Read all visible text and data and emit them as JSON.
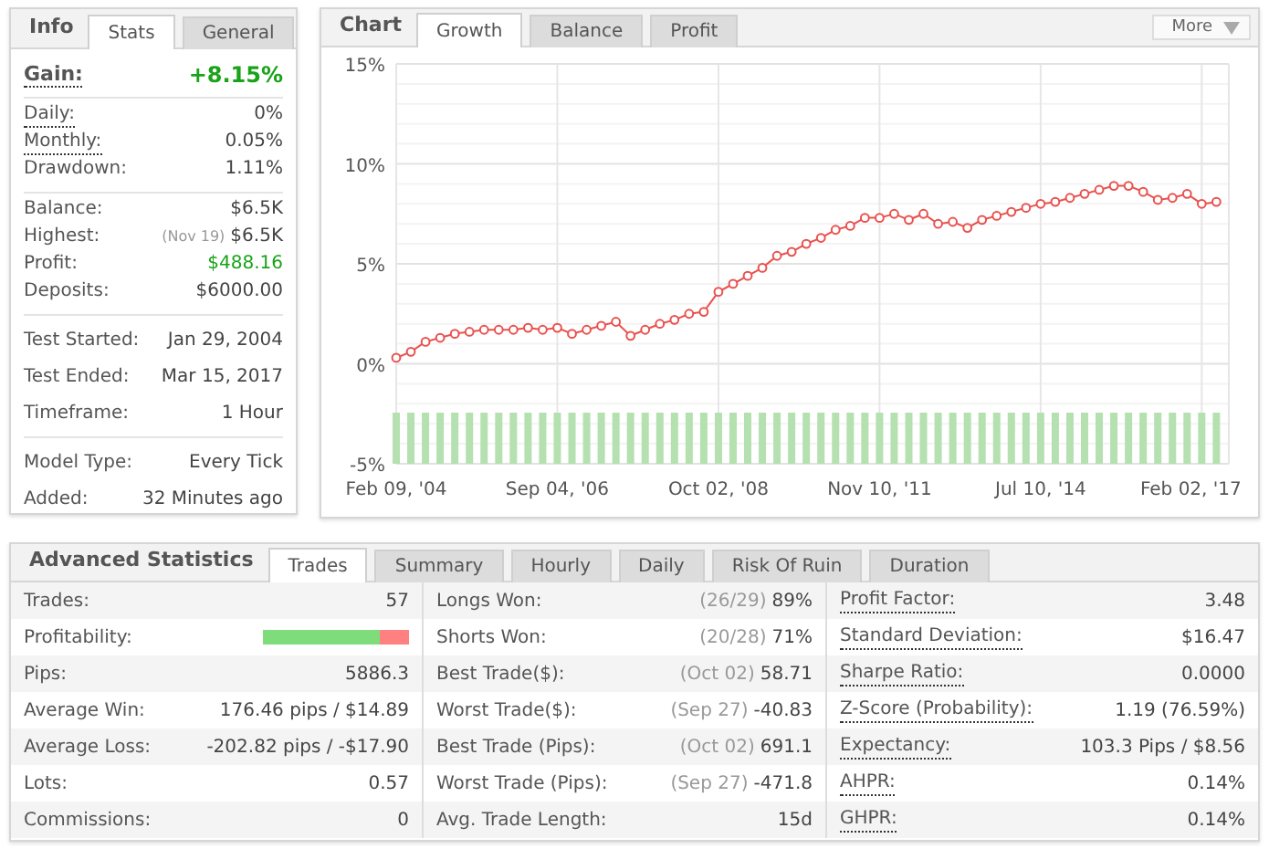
{
  "info": {
    "title": "Info",
    "tabs": [
      {
        "label": "Stats",
        "selected": true
      },
      {
        "label": "General",
        "selected": false
      }
    ],
    "gain": {
      "label": "Gain:",
      "value": "+8.15%",
      "dotted": true
    },
    "groups": [
      {
        "rows": [
          {
            "label": "Daily:",
            "value": "0%",
            "dotted": true,
            "positive": false
          },
          {
            "label": "Monthly:",
            "value": "0.05%",
            "dotted": true,
            "positive": false
          },
          {
            "label": "Drawdown:",
            "value": "1.11%",
            "dotted": false,
            "positive": false
          }
        ]
      },
      {
        "rows": [
          {
            "label": "Balance:",
            "value": "$6.5K",
            "dotted": false,
            "positive": false
          },
          {
            "label": "Highest:",
            "note": "(Nov 19)",
            "value": "$6.5K",
            "dotted": false,
            "positive": false
          },
          {
            "label": "Profit:",
            "value": "$488.16",
            "dotted": false,
            "positive": true
          },
          {
            "label": "Deposits:",
            "value": "$6000.00",
            "dotted": false,
            "positive": false
          }
        ]
      },
      {
        "rows": [
          {
            "label": "Test Started:",
            "value": "Jan 29, 2004",
            "dotted": false,
            "positive": false
          },
          {
            "label": "Test Ended:",
            "value": "Mar 15, 2017",
            "dotted": false,
            "positive": false
          },
          {
            "label": "Timeframe:",
            "value": "1 Hour",
            "dotted": false,
            "positive": false
          }
        ]
      },
      {
        "rows": [
          {
            "label": "Model Type:",
            "value": "Every Tick",
            "dotted": false,
            "positive": false
          },
          {
            "label": "Added:",
            "value": "32 Minutes ago",
            "dotted": false,
            "positive": false
          }
        ]
      }
    ]
  },
  "chart": {
    "title": "Chart",
    "tabs": [
      {
        "label": "Growth",
        "selected": true
      },
      {
        "label": "Balance",
        "selected": false
      },
      {
        "label": "Profit",
        "selected": false
      }
    ],
    "more": "More",
    "chart_data": {
      "type": "line",
      "categories": [
        "Feb 09, '04",
        null,
        null,
        null,
        null,
        null,
        null,
        null,
        null,
        null,
        null,
        "Sep 04, '06",
        null,
        null,
        null,
        null,
        null,
        null,
        null,
        null,
        null,
        null,
        "Oct 02, '08",
        null,
        null,
        null,
        null,
        null,
        null,
        null,
        null,
        null,
        null,
        "Nov 10, '11",
        null,
        null,
        null,
        null,
        null,
        null,
        null,
        null,
        null,
        null,
        "Jul 10, '14",
        null,
        null,
        null,
        null,
        null,
        null,
        null,
        null,
        null,
        null,
        "Feb 02, '17",
        null
      ],
      "grid": true,
      "series": [
        {
          "marker": true,
          "color": "#e8524f",
          "values": [
            0.3,
            0.6,
            1.1,
            1.3,
            1.5,
            1.6,
            1.7,
            1.7,
            1.7,
            1.8,
            1.7,
            1.8,
            1.5,
            1.7,
            1.9,
            2.1,
            1.4,
            1.7,
            2.0,
            2.2,
            2.5,
            2.6,
            3.6,
            4.0,
            4.4,
            4.8,
            5.4,
            5.6,
            6.0,
            6.3,
            6.7,
            6.9,
            7.3,
            7.3,
            7.5,
            7.2,
            7.5,
            7.0,
            7.1,
            6.8,
            7.2,
            7.4,
            7.6,
            7.8,
            8.0,
            8.1,
            8.3,
            8.5,
            8.7,
            8.9,
            8.9,
            8.6,
            8.2,
            8.3,
            8.5,
            8.0,
            8.1
          ]
        }
      ],
      "ylim": [
        -5,
        15
      ],
      "yticks": [
        {
          "value": 15,
          "label": "15%"
        },
        {
          "value": 10,
          "label": "10%"
        },
        {
          "value": 5,
          "label": "5%"
        },
        {
          "value": 0,
          "label": "0%"
        },
        {
          "value": -5,
          "label": "-5%"
        }
      ]
    }
  },
  "advanced": {
    "title": "Advanced Statistics",
    "tabs": [
      {
        "label": "Trades",
        "selected": true
      },
      {
        "label": "Summary",
        "selected": false
      },
      {
        "label": "Hourly",
        "selected": false
      },
      {
        "label": "Daily",
        "selected": false
      },
      {
        "label": "Risk Of Ruin",
        "selected": false
      },
      {
        "label": "Duration",
        "selected": false
      }
    ],
    "columns": [
      [
        {
          "kind": "text",
          "label": "Trades:",
          "value": "57",
          "dotted": false
        },
        {
          "kind": "bar",
          "label": "Profitability:",
          "level": 0.805,
          "dotted": false
        },
        {
          "kind": "text",
          "label": "Pips:",
          "value": "5886.3",
          "dotted": false
        },
        {
          "kind": "text",
          "label": "Average Win:",
          "value": "176.46 pips / $14.89",
          "dotted": false
        },
        {
          "kind": "text",
          "label": "Average Loss:",
          "value": "-202.82 pips / -$17.90",
          "dotted": false
        },
        {
          "kind": "text",
          "label": "Lots:",
          "value": "0.57",
          "dotted": false
        },
        {
          "kind": "text",
          "label": "Commissions:",
          "value": "0",
          "dotted": false
        }
      ],
      [
        {
          "kind": "text",
          "label": "Longs Won:",
          "note": "(26/29)",
          "value": "89%",
          "dotted": false
        },
        {
          "kind": "text",
          "label": "Shorts Won:",
          "note": "(20/28)",
          "value": "71%",
          "dotted": false
        },
        {
          "kind": "text",
          "label": "Best Trade($):",
          "note": "(Oct 02)",
          "value": "58.71",
          "dotted": false
        },
        {
          "kind": "text",
          "label": "Worst Trade($):",
          "note": "(Sep 27)",
          "value": "-40.83",
          "dotted": false
        },
        {
          "kind": "text",
          "label": "Best Trade (Pips):",
          "note": "(Oct 02)",
          "value": "691.1",
          "dotted": false
        },
        {
          "kind": "text",
          "label": "Worst Trade (Pips):",
          "note": "(Sep 27)",
          "value": "-471.8",
          "dotted": false
        },
        {
          "kind": "text",
          "label": "Avg. Trade Length:",
          "value": "15d",
          "dotted": false
        }
      ],
      [
        {
          "kind": "text",
          "label": "Profit Factor:",
          "value": "3.48",
          "dotted": true
        },
        {
          "kind": "text",
          "label": "Standard Deviation:",
          "value": "$16.47",
          "dotted": true
        },
        {
          "kind": "text",
          "label": "Sharpe Ratio:",
          "value": "0.0000",
          "dotted": true
        },
        {
          "kind": "text",
          "label": "Z-Score (Probability):",
          "value": "1.19 (76.59%)",
          "dotted": true
        },
        {
          "kind": "text",
          "label": "Expectancy:",
          "value": "103.3 Pips / $8.56",
          "dotted": true
        },
        {
          "kind": "text",
          "label": "AHPR:",
          "value": "0.14%",
          "dotted": true
        },
        {
          "kind": "text",
          "label": "GHPR:",
          "value": "0.14%",
          "dotted": true
        }
      ]
    ]
  }
}
